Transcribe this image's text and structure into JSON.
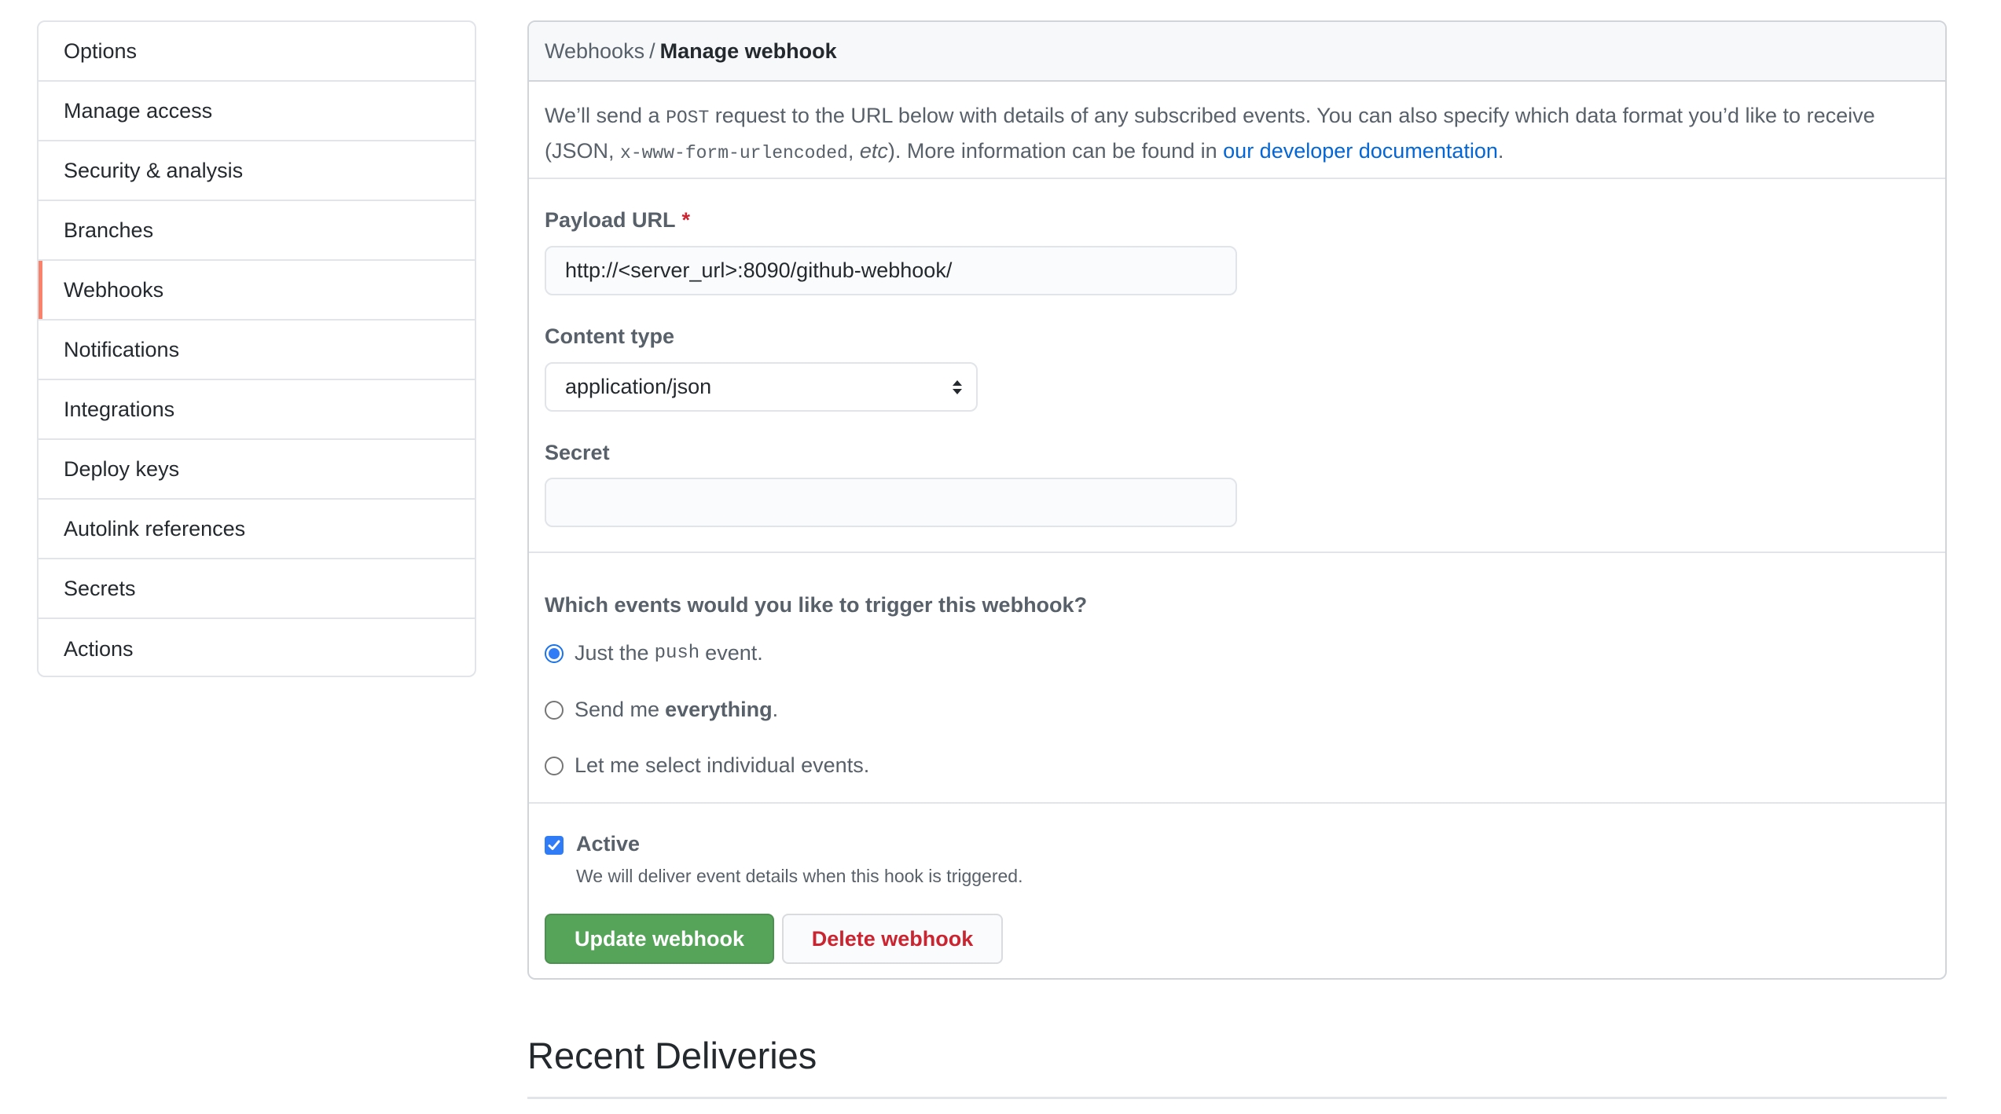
{
  "sidebar": {
    "items": [
      {
        "label": "Options"
      },
      {
        "label": "Manage access"
      },
      {
        "label": "Security & analysis"
      },
      {
        "label": "Branches"
      },
      {
        "label": "Webhooks",
        "active": true
      },
      {
        "label": "Notifications"
      },
      {
        "label": "Integrations"
      },
      {
        "label": "Deploy keys"
      },
      {
        "label": "Autolink references"
      },
      {
        "label": "Secrets"
      },
      {
        "label": "Actions"
      }
    ]
  },
  "breadcrumb": {
    "parent": "Webhooks",
    "separator": "/",
    "current": "Manage webhook"
  },
  "intro": {
    "part1": "We’ll send a ",
    "method": "POST",
    "part2": " request to the URL below with details of any subscribed events. You can also specify which data format you’d like to receive (JSON, ",
    "format": "x-www-form-urlencoded",
    "part3": ", ",
    "etc": "etc",
    "part4": "). More information can be found in ",
    "link": "our developer documentation",
    "part5": "."
  },
  "form": {
    "payload_url": {
      "label": "Payload URL",
      "required_mark": "*",
      "value": "http://<server_url>:8090/github-webhook/"
    },
    "content_type": {
      "label": "Content type",
      "value": "application/json"
    },
    "secret": {
      "label": "Secret",
      "value": ""
    }
  },
  "events": {
    "question": "Which events would you like to trigger this webhook?",
    "options": [
      {
        "pre": "Just the",
        "code": "push",
        "post": "event.",
        "checked": true
      },
      {
        "pre": "Send me",
        "bold": "everything",
        "post": ".",
        "checked": false
      },
      {
        "pre": "Let me select individual events.",
        "checked": false
      }
    ]
  },
  "active": {
    "label": "Active",
    "checked": true,
    "note": "We will deliver event details when this hook is triggered."
  },
  "buttons": {
    "update": "Update webhook",
    "delete": "Delete webhook"
  },
  "recent_deliveries": {
    "title": "Recent Deliveries"
  },
  "colors": {
    "accent_active": "#f9826c",
    "primary_button": "#56a35a",
    "danger_text": "#cb2431",
    "link": "#0366d6",
    "radio_checked": "#2f7cf6"
  }
}
